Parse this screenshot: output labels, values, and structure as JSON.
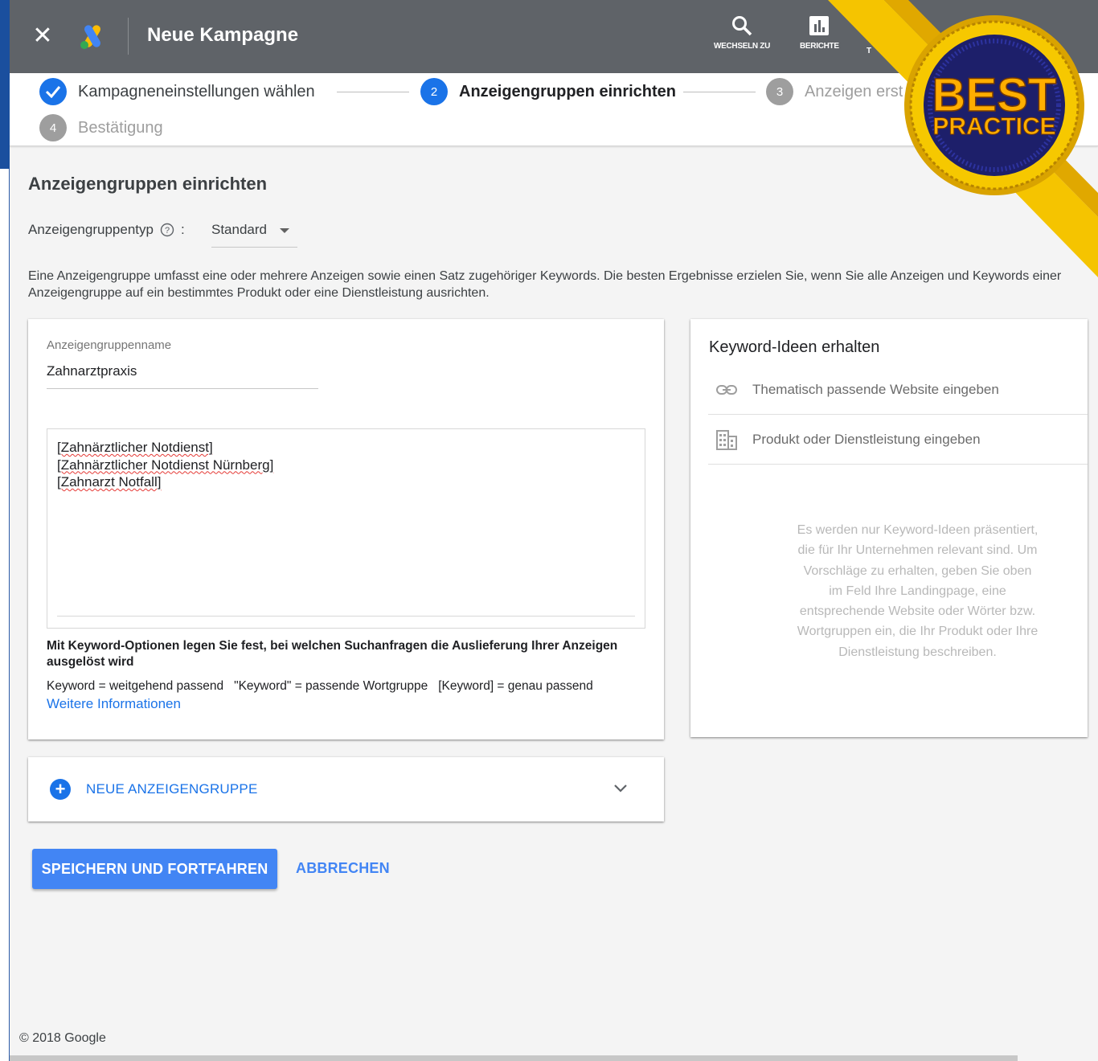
{
  "appbar": {
    "title": "Neue Kampagne",
    "tools": [
      {
        "label": "WECHSELN ZU",
        "icon": "search-icon"
      },
      {
        "label": "BERICHTE",
        "icon": "reports-icon"
      },
      {
        "label": "T",
        "icon": "tools-icon"
      }
    ]
  },
  "stepper": {
    "steps": [
      {
        "number": "",
        "label": "Kampagneneinstellungen wählen",
        "state": "done"
      },
      {
        "number": "2",
        "label": "Anzeigengruppen einrichten",
        "state": "active"
      },
      {
        "number": "3",
        "label": "Anzeigen erst",
        "state": "pending"
      },
      {
        "number": "4",
        "label": "Bestätigung",
        "state": "pending"
      }
    ]
  },
  "section_title": "Anzeigengruppen einrichten",
  "adgroup_type": {
    "label": "Anzeigengruppentyp",
    "separator": ":",
    "value": "Standard"
  },
  "intro_text": "Eine Anzeigengruppe umfasst eine oder mehrere Anzeigen sowie einen Satz zugehöriger Keywords. Die besten Ergebnisse erzielen Sie, wenn Sie alle Anzeigen und Keywords einer Anzeigengruppe auf ein bestimmtes Produkt oder eine Dienstleistung ausrichten.",
  "adgroup_card": {
    "name_label": "Anzeigengruppenname",
    "name_value": "Zahnarztpraxis",
    "keywords": [
      "[Zahnärztlicher Notdienst]",
      "[Zahnärztlicher Notdienst Nürnberg]",
      "[Zahnarzt Notfall]"
    ],
    "options_title": "Mit Keyword-Optionen legen Sie fest, bei welchen Suchanfragen die Auslieferung Ihrer Anzeigen ausgelöst wird",
    "options_desc": "Keyword = weitgehend passend   \"Keyword\" = passende Wortgruppe   [Keyword] = genau passend",
    "more_link": "Weitere Informationen"
  },
  "keyword_ideas": {
    "title": "Keyword-Ideen erhalten",
    "website_placeholder": "Thematisch passende Website eingeben",
    "product_placeholder": "Produkt oder Dienstleistung eingeben",
    "note": "Es werden nur Keyword-Ideen präsentiert, die für Ihr Unternehmen relevant sind. Um Vorschläge zu erhalten, geben Sie oben im Feld Ihre Landingpage, eine entsprechende Website oder Wörter bzw. Wortgruppen ein, die Ihr Produkt oder Ihre Dienstleistung beschreiben."
  },
  "new_adgroup_label": "NEUE ANZEIGENGRUPPE",
  "buttons": {
    "save": "SPEICHERN UND FORTFAHREN",
    "cancel": "ABBRECHEN"
  },
  "footer": "© 2018 Google",
  "badge": {
    "line1": "BEST",
    "line2": "PRACTICE"
  },
  "colors": {
    "appbar": "#5f6368",
    "primary": "#1a73e8",
    "button": "#4285f4",
    "ribbon": "#f5c400"
  }
}
